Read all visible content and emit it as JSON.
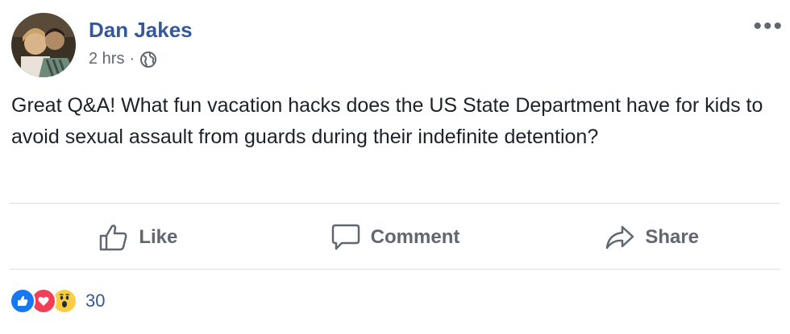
{
  "post": {
    "author": "Dan Jakes",
    "timestamp": "2 hrs",
    "separator": "·",
    "privacy_icon": "globe-icon",
    "more_icon": "more-options-icon",
    "text": "Great Q&A! What fun vacation hacks does the US State Department have for kids to avoid sexual assault from guards during their indefinite detention?"
  },
  "actions": {
    "like": "Like",
    "comment": "Comment",
    "share": "Share"
  },
  "reactions": {
    "types": [
      "like",
      "love",
      "wow"
    ],
    "count": "30"
  },
  "colors": {
    "author": "#365899",
    "action_text": "#606770",
    "like_blue": "#1877f2",
    "love_red": "#f33e58",
    "wow_yellow": "#fbcd45"
  }
}
